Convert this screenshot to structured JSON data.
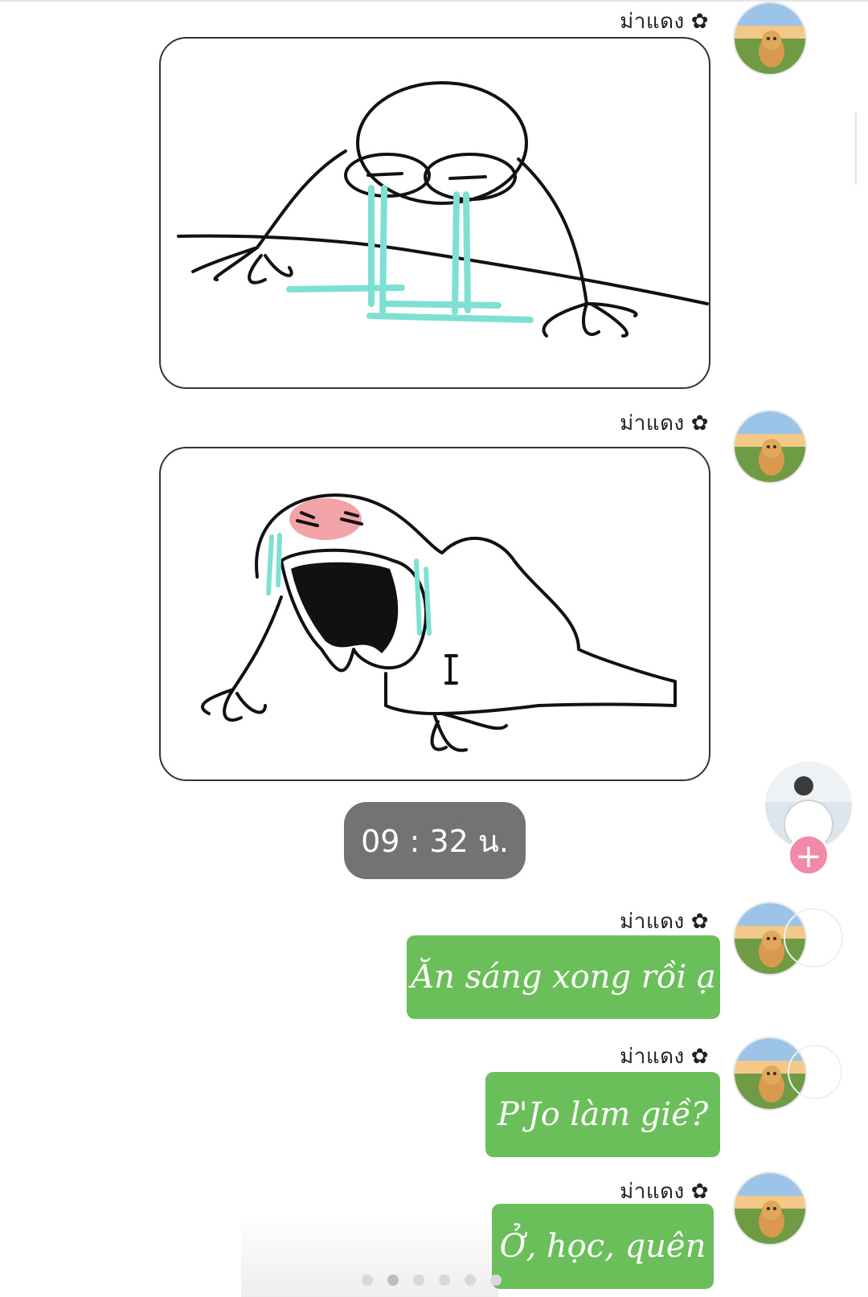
{
  "messages": [
    {
      "sender": "ม่าแดง",
      "flower": "✿",
      "type": "sticker"
    },
    {
      "sender": "ม่าแดง",
      "flower": "✿",
      "type": "sticker"
    },
    {
      "sender": "ม่าแดง",
      "flower": "✿",
      "type": "text",
      "text": "Ăn sáng xong rồi ạ"
    },
    {
      "sender": "ม่าแดง",
      "flower": "✿",
      "type": "text",
      "text": "P'Jo làm giề?"
    },
    {
      "sender": "ม่าแดง",
      "flower": "✿",
      "type": "text",
      "text": "Ở, học, quên"
    }
  ],
  "time_divider": "09 : 32 น.",
  "story": {
    "add_symbol": "+"
  },
  "colors": {
    "bubble": "#6bbf5a",
    "time_pill": "#737373",
    "plus_badge": "#f08aa8",
    "tears": "#7ee0d2",
    "cheek": "#f2a3a8"
  },
  "icons": [
    "flower-icon",
    "avatar",
    "add-story-icon",
    "page-dot"
  ]
}
